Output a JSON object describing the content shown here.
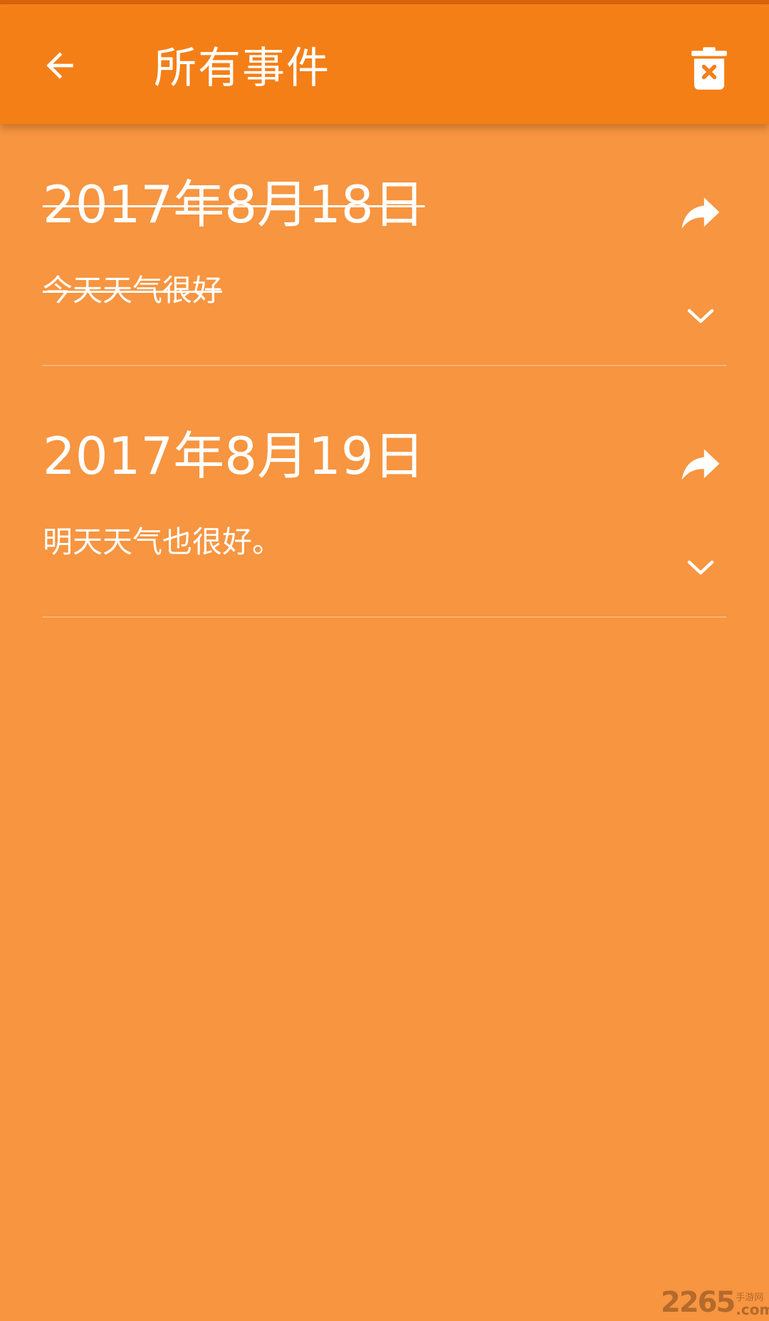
{
  "app_bar": {
    "title": "所有事件",
    "back_icon": "arrow-left-icon",
    "delete_icon": "trash-x-icon"
  },
  "events": [
    {
      "date": "2017年8月18日",
      "text": "今天天气很好",
      "completed": true
    },
    {
      "date": "2017年8月19日",
      "text": "明天天气也很好。",
      "completed": false
    }
  ],
  "watermark": {
    "number": "2265",
    "tag": "手游网",
    "domain": ".com"
  },
  "colors": {
    "background": "#F79540",
    "app_bar": "#F57F17",
    "status_strip": "#D8630A",
    "text": "#FFFFFF"
  }
}
